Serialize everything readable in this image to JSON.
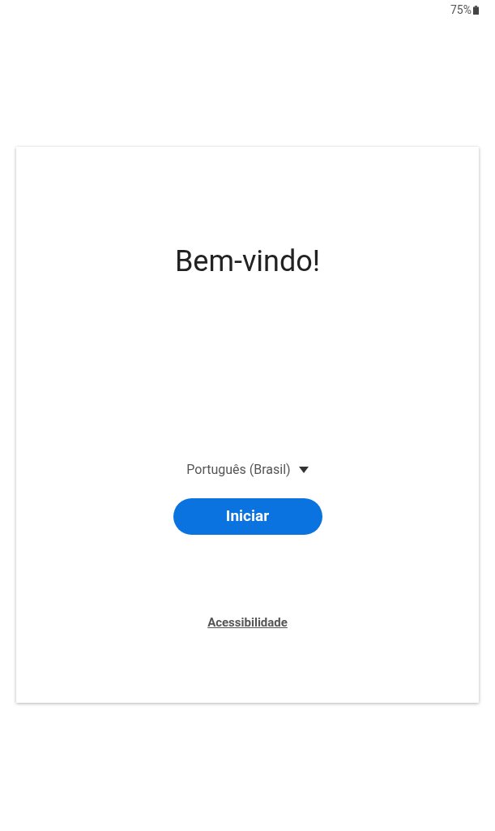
{
  "status_bar": {
    "battery": "75%"
  },
  "welcome": {
    "title": "Bem-vindo!",
    "language": "Português (Brasil)",
    "start_button": "Iniciar",
    "accessibility_link": "Acessibilidade"
  }
}
